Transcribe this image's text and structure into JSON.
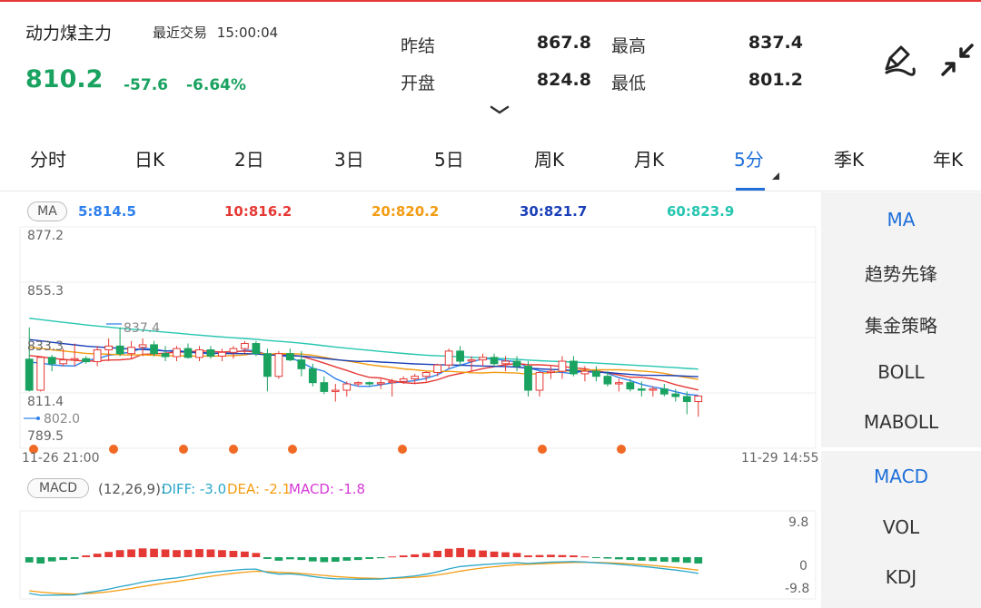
{
  "header": {
    "name": "动力煤主力",
    "status": "最近交易",
    "time": "15:00:04",
    "price": "810.2",
    "change": "-57.6",
    "change_pct": "-6.64%",
    "stats": [
      {
        "label": "昨结",
        "value": "867.8"
      },
      {
        "label": "开盘",
        "value": "824.8"
      },
      {
        "label": "最高",
        "value": "837.4"
      },
      {
        "label": "最低",
        "value": "801.2"
      }
    ],
    "icons": [
      "pen-icon",
      "collapse-icon",
      "chevron-down-icon"
    ]
  },
  "tabs": [
    {
      "label": "分时"
    },
    {
      "label": "日K"
    },
    {
      "label": "2日"
    },
    {
      "label": "3日"
    },
    {
      "label": "5日"
    },
    {
      "label": "周K"
    },
    {
      "label": "月K"
    },
    {
      "label": "5分"
    },
    {
      "label": "季K"
    },
    {
      "label": "年K"
    }
  ],
  "active_tab": "5分",
  "side_panel": {
    "main_indicators": [
      "MA",
      "趋势先锋",
      "集金策略",
      "BOLL",
      "MABOLL"
    ],
    "sub_indicators": [
      "MACD",
      "VOL",
      "KDJ"
    ],
    "active_main": "MA",
    "active_sub": "MACD"
  },
  "ma_panel": {
    "badge": "MA",
    "values": [
      {
        "text": "5:814.5",
        "color": "#2f80ed"
      },
      {
        "text": "10:816.2",
        "color": "#e53935"
      },
      {
        "text": "20:820.2",
        "color": "#f39c12"
      },
      {
        "text": "30:821.7",
        "color": "#1a3fb8"
      },
      {
        "text": "60:823.9",
        "color": "#26c6b0"
      }
    ],
    "y_labels": [
      "877.2",
      "855.3",
      "833.3",
      "811.4",
      "789.5"
    ],
    "x_labels": [
      "11-26 21:00",
      "11-29 14:55"
    ],
    "annotations": [
      "837.4",
      "802.0"
    ]
  },
  "macd_panel": {
    "badge": "MACD",
    "params": "(12,26,9):",
    "diff": {
      "text": "DIFF: -3.0",
      "color": "#2aa7c9"
    },
    "dea": {
      "text": "DEA: -2.1",
      "color": "#f39c12"
    },
    "macd": {
      "text": "MACD: -1.8",
      "color": "#d63ad6"
    },
    "y_labels": [
      "9.8",
      "0",
      "-9.8"
    ]
  },
  "colors": {
    "up": "#e53935",
    "down": "#1aa260",
    "accent": "#1e6fd9",
    "dot": "#f06a25"
  },
  "chart_data": {
    "type": "candlestick",
    "y_range": [
      789.5,
      877.2
    ],
    "candles_ohlc": [
      [
        824.8,
        837.4,
        812,
        812.5
      ],
      [
        812.5,
        826,
        812,
        825.5
      ],
      [
        825.5,
        826.5,
        820,
        823
      ],
      [
        823,
        829,
        822,
        824.5
      ],
      [
        824.5,
        831,
        822,
        825
      ],
      [
        825,
        826,
        823,
        823.8
      ],
      [
        823.8,
        830,
        822,
        828.5
      ],
      [
        828.5,
        833,
        824,
        830
      ],
      [
        830,
        837.4,
        826,
        827
      ],
      [
        827,
        832,
        825,
        829.5
      ],
      [
        829.5,
        833,
        826,
        830.5
      ],
      [
        830.5,
        832,
        826,
        827
      ],
      [
        827,
        830,
        824,
        825.8
      ],
      [
        825.8,
        830,
        824,
        829
      ],
      [
        829,
        831,
        825,
        825.5
      ],
      [
        825.5,
        830,
        824,
        828.5
      ],
      [
        828.5,
        830,
        825,
        826
      ],
      [
        826,
        829,
        824,
        827.5
      ],
      [
        827.5,
        830,
        825,
        829
      ],
      [
        829,
        832,
        827,
        831
      ],
      [
        831,
        832,
        826,
        827
      ],
      [
        827,
        829,
        812,
        818
      ],
      [
        818,
        828,
        817,
        827
      ],
      [
        827,
        829,
        824,
        824.5
      ],
      [
        824.5,
        828,
        818,
        821
      ],
      [
        821,
        823,
        814,
        815.5
      ],
      [
        815.5,
        818,
        811,
        812
      ],
      [
        812,
        815,
        808,
        812.5
      ],
      [
        812.5,
        816,
        810,
        815
      ],
      [
        815,
        816,
        814,
        815.5
      ],
      [
        815.5,
        816,
        814,
        815
      ],
      [
        815,
        817,
        813,
        815.5
      ],
      [
        815.5,
        817,
        810,
        816
      ],
      [
        816,
        818,
        815,
        817
      ],
      [
        817,
        819,
        815,
        818
      ],
      [
        818,
        820,
        816,
        819.5
      ],
      [
        819.5,
        823,
        818,
        822.5
      ],
      [
        822.5,
        829,
        821,
        828
      ],
      [
        828,
        830,
        822,
        824
      ],
      [
        824,
        826,
        820,
        824.5
      ],
      [
        824.5,
        827,
        822,
        825.5
      ],
      [
        825.5,
        827,
        822,
        823
      ],
      [
        823,
        826,
        820,
        824
      ],
      [
        824,
        826,
        820,
        822
      ],
      [
        822,
        824,
        810,
        812.5
      ],
      [
        812.5,
        820,
        810,
        819.5
      ],
      [
        819.5,
        822,
        817,
        820
      ],
      [
        820,
        826,
        817,
        824
      ],
      [
        824,
        826,
        818,
        819
      ],
      [
        819,
        822,
        816,
        820
      ],
      [
        820,
        822,
        816,
        818
      ],
      [
        818,
        820,
        814,
        815
      ],
      [
        815,
        817,
        812,
        815.5
      ],
      [
        815.5,
        817,
        812,
        813
      ],
      [
        813,
        816,
        810,
        812.5
      ],
      [
        812.5,
        814,
        810,
        813
      ],
      [
        813,
        815,
        810,
        811
      ],
      [
        811,
        813,
        808,
        810
      ],
      [
        810,
        812,
        803,
        808
      ],
      [
        808,
        810,
        802,
        810.2
      ]
    ],
    "macd_histogram": [
      -1.5,
      -1.8,
      -1.2,
      -0.8,
      -0.5,
      0.5,
      1.0,
      1.5,
      2.0,
      2.2,
      2.5,
      2.4,
      2.2,
      2.0,
      2.1,
      2.3,
      2.2,
      2.0,
      1.8,
      1.6,
      1.2,
      -0.5,
      -1.0,
      -0.6,
      -0.8,
      -1.2,
      -1.4,
      -1.3,
      -1.0,
      -0.8,
      -0.5,
      -0.3,
      0.2,
      0.5,
      0.8,
      1.2,
      1.8,
      2.4,
      2.6,
      2.2,
      1.9,
      1.6,
      1.4,
      1.2,
      0.5,
      0.6,
      0.7,
      0.6,
      0.5,
      0.2,
      -0.2,
      -0.4,
      -0.6,
      -0.8,
      -1.0,
      -1.1,
      -1.3,
      -1.4,
      -1.6,
      -1.8
    ]
  }
}
